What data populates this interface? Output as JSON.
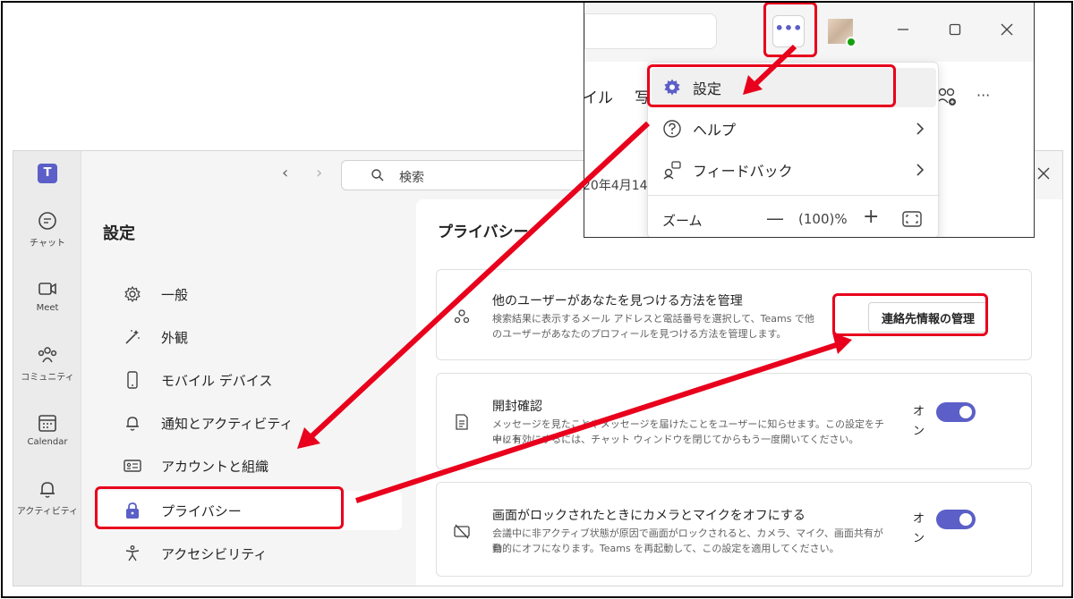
{
  "rail": {
    "items": [
      {
        "label": "チャット",
        "icon": "chat-icon"
      },
      {
        "label": "Meet",
        "icon": "video-icon"
      },
      {
        "label": "コミュニティ",
        "icon": "community-icon"
      },
      {
        "label": "Calendar",
        "icon": "calendar-icon"
      },
      {
        "label": "アクティビティ",
        "icon": "bell-icon"
      }
    ]
  },
  "topbar": {
    "search_placeholder": "検索"
  },
  "settings": {
    "title": "設定",
    "nav": [
      {
        "label": "一般",
        "icon": "gear-icon"
      },
      {
        "label": "外観",
        "icon": "magic-wand-icon"
      },
      {
        "label": "モバイル デバイス",
        "icon": "phone-icon"
      },
      {
        "label": "通知とアクティビティ",
        "icon": "bell-icon"
      },
      {
        "label": "アカウントと組織",
        "icon": "id-card-icon"
      },
      {
        "label": "プライバシー",
        "icon": "lock-icon"
      },
      {
        "label": "アクセシビリティ",
        "icon": "accessibility-icon"
      }
    ],
    "selected": "プライバシー"
  },
  "privacy": {
    "heading": "プライバシー",
    "discover": {
      "title": "他のユーザーがあなたを見つける方法を管理",
      "desc_line1": "検索結果に表示するメール アドレスと電話番号を選択して、Teams で他",
      "desc_line2": "のユーザーがあなたのプロフィールを見つける方法を管理します。",
      "button": "連絡先情報の管理"
    },
    "read_receipts": {
      "title": "開封確認",
      "desc_line1": "メッセージを見たことやメッセージを届けたことをユーザーに知らせます。この設定をチャット",
      "desc_line2": "中に有効にするには、チャット ウィンドウを閉じてからもう一度開いてください。",
      "state": "オン"
    },
    "lock_camera": {
      "title": "画面がロックされたときにカメラとマイクをオフにする",
      "desc_line1": "会議中に非アクティブ状態が原因で画面がロックされると、カメラ、マイク、画面共有が自",
      "desc_line2": "動的にオフになります。Teams を再起動して、この設定を適用してください。",
      "state": "オン"
    }
  },
  "overlay": {
    "more_label": "•••",
    "bg_tab1": "イル",
    "bg_tab2": "写",
    "bg_date": "20年4月14",
    "menu": {
      "settings": "設定",
      "help": "ヘルプ",
      "feedback": "フィードバック",
      "zoom_label": "ズーム",
      "zoom_minus": "—",
      "zoom_value": "(100)%",
      "zoom_plus": "+"
    }
  },
  "colors": {
    "accent": "#5b5fc7",
    "highlight": "#e8001c"
  }
}
